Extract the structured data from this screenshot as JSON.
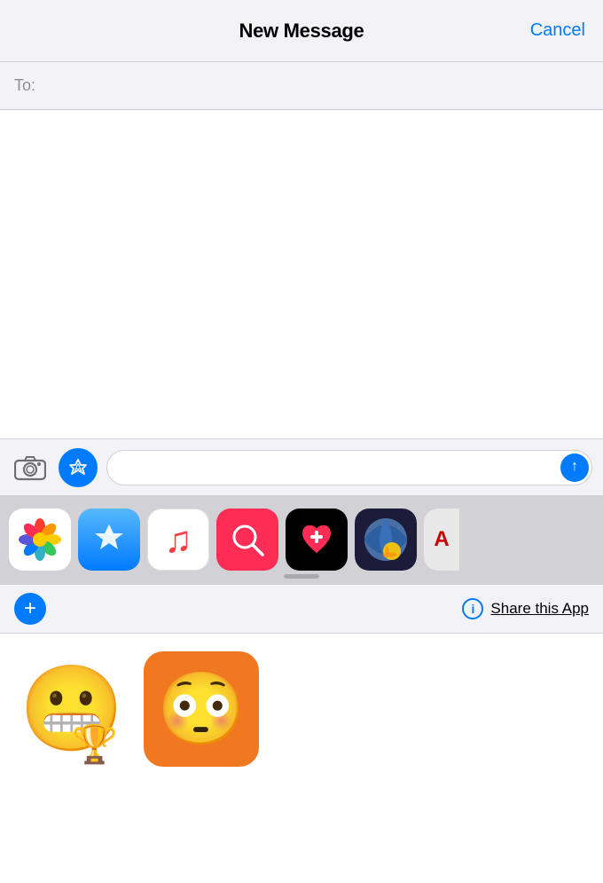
{
  "header": {
    "title": "New Message",
    "cancel_label": "Cancel"
  },
  "to_field": {
    "label": "To:",
    "placeholder": ""
  },
  "message_input": {
    "placeholder": ""
  },
  "buttons": {
    "cancel": "Cancel",
    "send": "↑",
    "plus": "+",
    "share_this_app": "Share this App",
    "info_symbol": "i"
  },
  "apps_shelf": {
    "items": [
      {
        "name": "Photos",
        "bg": "#ffffff"
      },
      {
        "name": "App Store",
        "bg": "#007aff"
      },
      {
        "name": "Music",
        "bg": "#ffffff"
      },
      {
        "name": "Web Search",
        "bg": "#ff2d55"
      },
      {
        "name": "Heart App",
        "bg": "#000000"
      },
      {
        "name": "Globe App",
        "bg": "#1a1a2e"
      },
      {
        "name": "AD App",
        "bg": "#e8e8e8"
      }
    ]
  },
  "stickers": [
    {
      "emoji": "😬🏆",
      "label": "trophy emoji"
    },
    {
      "emoji": "😳",
      "label": "anxious emoji orange bg"
    }
  ],
  "colors": {
    "accent": "#007aff",
    "cancel": "#007aff",
    "background": "#f2f2f7"
  }
}
